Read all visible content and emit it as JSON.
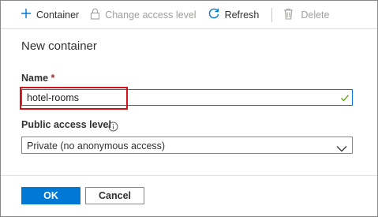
{
  "toolbar": {
    "container_label": "Container",
    "change_access_label": "Change access level",
    "refresh_label": "Refresh",
    "delete_label": "Delete"
  },
  "dialog": {
    "title": "New container",
    "name_label": "Name",
    "name_required_marker": "*",
    "name_value": "hotel-rooms",
    "access_label": "Public access level",
    "access_value": "Private (no anonymous access)",
    "ok_label": "OK",
    "cancel_label": "Cancel"
  },
  "colors": {
    "accent": "#0078d4",
    "highlight": "#d0131b",
    "valid_check": "#57a300"
  },
  "icons": [
    "plus-icon",
    "lock-icon",
    "refresh-icon",
    "trash-icon",
    "checkmark-icon",
    "info-icon",
    "chevron-down-icon"
  ]
}
